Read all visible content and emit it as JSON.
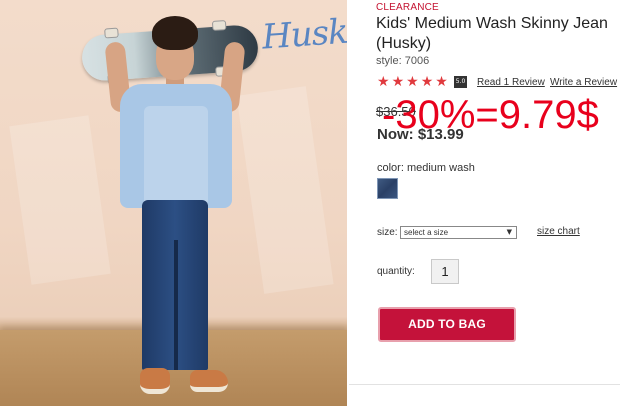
{
  "product_image": {
    "brand_logo": "Husky",
    "icon": "product-photo"
  },
  "product": {
    "badge": "CLEARANCE",
    "title": "Kids' Medium Wash Skinny Jean (Husky)",
    "style": "style: 7006",
    "rating_stars": 5,
    "rating_badge": "5.0",
    "read_reviews": "Read 1 Review",
    "write_review": "Write a Review",
    "original_price": "$36.50",
    "now_price": "Now: $13.99",
    "overlay_text": "-30%=9.79$",
    "color_label": "color: medium wash",
    "size_label": "size:",
    "size_placeholder": "select a size",
    "size_chart": "size chart",
    "quantity_label": "quantity:",
    "quantity_value": "1",
    "add_to_bag": "ADD TO BAG"
  },
  "colors": {
    "accent": "#c4123a",
    "star": "#e03a3e",
    "overlay": "#e8001c",
    "clearance": "#c41230"
  }
}
